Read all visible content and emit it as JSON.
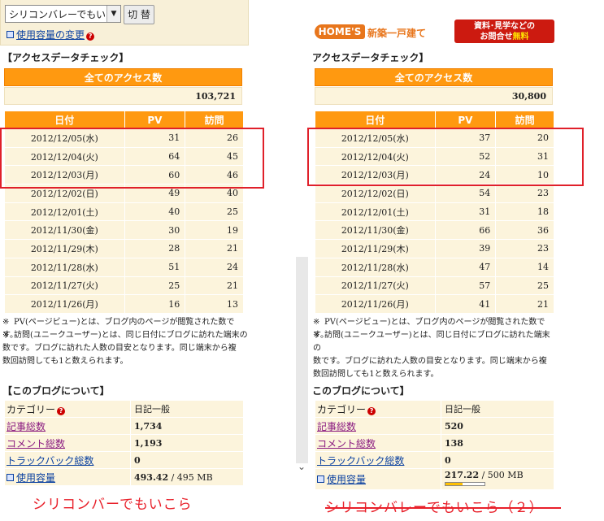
{
  "left": {
    "select_value": "シリコンバレーでもい",
    "switch_button": "切 替",
    "usage_link": "使用容量の変更",
    "access_section_title": "【アクセスデータチェック】",
    "all_access_header": "全てのアクセス数",
    "all_access_total": "103,721",
    "columns": [
      "日付",
      "PV",
      "訪問"
    ],
    "rows": [
      [
        "2012/12/05(水)",
        "31",
        "26"
      ],
      [
        "2012/12/04(火)",
        "64",
        "45"
      ],
      [
        "2012/12/03(月)",
        "60",
        "46"
      ],
      [
        "2012/12/02(日)",
        "49",
        "40"
      ],
      [
        "2012/12/01(土)",
        "40",
        "25"
      ],
      [
        "2012/11/30(金)",
        "30",
        "19"
      ],
      [
        "2012/11/29(木)",
        "28",
        "21"
      ],
      [
        "2012/11/28(水)",
        "51",
        "24"
      ],
      [
        "2012/11/27(火)",
        "25",
        "21"
      ],
      [
        "2012/11/26(月)",
        "16",
        "13"
      ]
    ],
    "note_mark": "※",
    "note1": "PV(ページビュー)とは、ブログ内のページが閲覧された数です。",
    "note2_l1": "訪問(ユニークユーザー)とは、同じ日付にブログに訪れた端末の",
    "note2_l2": "数です。ブログに訪れた人数の目安となります。同じ端末から複",
    "note2_l3": "数回訪問しても1と数えられます。",
    "about_title": "【このブログについて】",
    "about": {
      "category_label": "カテゴリー",
      "category_value": "日記一般",
      "articles_label": "記事総数",
      "articles_value": "1,734",
      "comments_label": "コメント総数",
      "comments_value": "1,193",
      "trackbacks_label": "トラックバック総数",
      "trackbacks_value": "0",
      "usage_label": "使用容量",
      "usage_value": "493.42",
      "usage_total": " / 495 MB"
    },
    "caption": "シリコンバーでもいこら"
  },
  "right": {
    "banner_logo": "HOME'S",
    "banner_text": "新築一戸建て",
    "banner_cta_l1": "資料･見学などの",
    "banner_cta_l2": "お問合せ",
    "banner_cta_free": "無料",
    "access_section_title": "アクセスデータチェック】",
    "all_access_header": "全てのアクセス数",
    "all_access_total": "30,800",
    "columns": [
      "日付",
      "PV",
      "訪問"
    ],
    "rows": [
      [
        "2012/12/05(水)",
        "37",
        "20"
      ],
      [
        "2012/12/04(火)",
        "52",
        "31"
      ],
      [
        "2012/12/03(月)",
        "24",
        "10"
      ],
      [
        "2012/12/02(日)",
        "54",
        "23"
      ],
      [
        "2012/12/01(土)",
        "31",
        "18"
      ],
      [
        "2012/11/30(金)",
        "66",
        "36"
      ],
      [
        "2012/11/29(木)",
        "39",
        "23"
      ],
      [
        "2012/11/28(水)",
        "47",
        "14"
      ],
      [
        "2012/11/27(火)",
        "57",
        "25"
      ],
      [
        "2012/11/26(月)",
        "41",
        "21"
      ]
    ],
    "note_mark": "※",
    "note1": "PV(ページビュー)とは、ブログ内のページが閲覧された数です。",
    "note2_l1": "訪問(ユニークユーザー)とは、同じ日付にブログに訪れた端末の",
    "note2_l2": "数です。ブログに訪れた人数の目安となります。同じ端末から複",
    "note2_l3": "数回訪問しても1と数えられます。",
    "about_title": "このブログについて】",
    "about": {
      "category_label": "カテゴリー",
      "category_value": "日記一般",
      "articles_label": "記事総数",
      "articles_value": "520",
      "comments_label": "コメント総数",
      "comments_value": "138",
      "trackbacks_label": "トラックバック総数",
      "trackbacks_value": "0",
      "usage_label": "使用容量",
      "usage_value": "217.22",
      "usage_total": " / 500 MB",
      "usage_fraction": 0.43
    },
    "caption": "シリコンバレーでもいこら（２）"
  },
  "colors": {
    "header_orange": "#ff9910",
    "row_cream": "#fcf4dc",
    "highlight_red": "#e0202a"
  }
}
